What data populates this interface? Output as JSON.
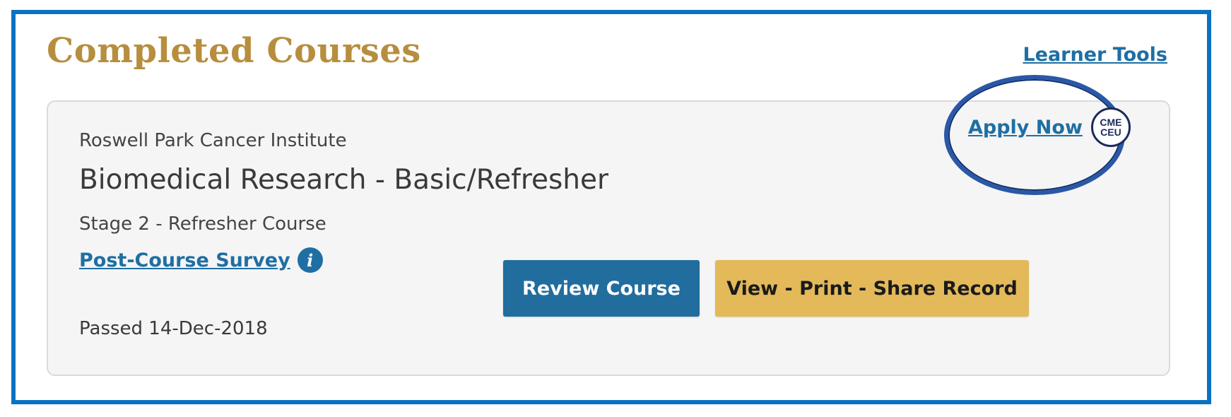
{
  "header": {
    "title": "Completed Courses",
    "learner_tools_label": "Learner Tools"
  },
  "course": {
    "institution": "Roswell Park Cancer Institute",
    "title": "Biomedical Research - Basic/Refresher",
    "stage": "Stage 2 - Refresher Course",
    "survey_label": "Post-Course Survey",
    "info_icon_glyph": "i",
    "passed_text": "Passed 14-Dec-2018",
    "apply_label": "Apply Now",
    "badge": {
      "line1": "CME",
      "line2": "CEU"
    },
    "review_button_label": "Review Course",
    "record_button_label": "View - Print - Share Record"
  },
  "icons": {
    "info": "info-icon",
    "badge": "cme-ceu-badge-icon"
  },
  "colors": {
    "frame_border": "#0a72c2",
    "heading": "#b78e3e",
    "link": "#1e6fa3",
    "review_button": "#216d9e",
    "record_button": "#e3b95a",
    "highlight_oval": "#2a58a6"
  }
}
